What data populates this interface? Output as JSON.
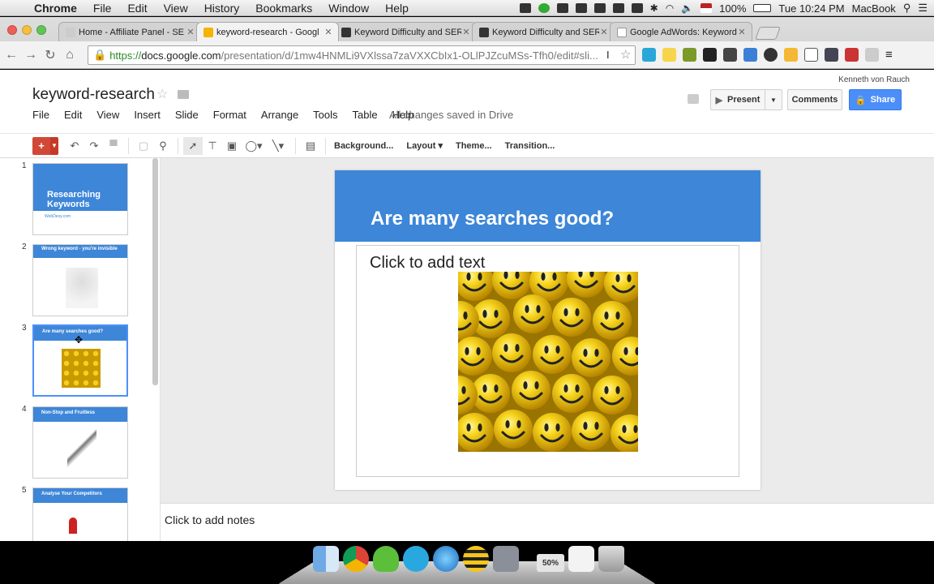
{
  "menubar": {
    "app": "Chrome",
    "items": [
      "File",
      "Edit",
      "View",
      "History",
      "Bookmarks",
      "Window",
      "Help"
    ],
    "battery": "100%",
    "clock": "Tue 10:24 PM",
    "computer_name": "MacBook"
  },
  "browser": {
    "tabs": [
      {
        "title": "Home - Affiliate Panel - SE",
        "favicon_color": "#cccccc"
      },
      {
        "title": "keyword-research - Googl",
        "favicon_color": "#f4b400"
      },
      {
        "title": "Keyword Difficulty and SER",
        "favicon_color": "#333333"
      },
      {
        "title": "Keyword Difficulty and SER",
        "favicon_color": "#333333"
      },
      {
        "title": "Google AdWords: Keyword",
        "favicon_color": "#ffffff"
      }
    ],
    "url_scheme": "https://",
    "url_domain": "docs.google.com",
    "url_path": "/presentation/d/1mw4HNMLi9VXlssa7zaVXXCbIx1-OLlPJZcuMSs-Tfh0/edit#sli..."
  },
  "doc": {
    "title": "keyword-research",
    "menu": [
      "File",
      "Edit",
      "View",
      "Insert",
      "Slide",
      "Format",
      "Arrange",
      "Tools",
      "Table",
      "Help"
    ],
    "saved_status": "All changes saved in Drive",
    "user": "Kenneth von Rauch",
    "present_label": "Present",
    "comments_label": "Comments",
    "share_label": "Share"
  },
  "toolbar": {
    "background_label": "Background...",
    "layout_label": "Layout",
    "theme_label": "Theme...",
    "transition_label": "Transition..."
  },
  "slides": [
    {
      "num": "1",
      "title": "Researching Keywords",
      "subtitle": "WebDesy.com"
    },
    {
      "num": "2",
      "title": "Wrong keyword - you're invisible"
    },
    {
      "num": "3",
      "title": "Are many searches good?"
    },
    {
      "num": "4",
      "title": "Non-Stop and Fruitless"
    },
    {
      "num": "5",
      "title": "Analyse Your Competitors"
    }
  ],
  "current_slide": {
    "title": "Are many searches good?",
    "placeholder": "Click to add text"
  },
  "notes_placeholder": "Click to add notes",
  "dock": {
    "badge": "50%"
  },
  "colors": {
    "accent": "#3d86d8",
    "share": "#4c8ef7",
    "add": "#d14836"
  }
}
